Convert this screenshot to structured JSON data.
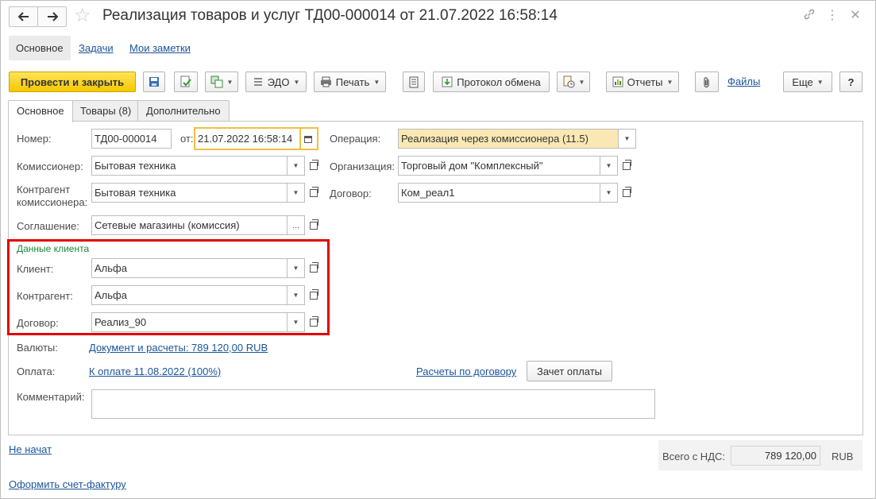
{
  "window": {
    "title": "Реализация товаров и услуг ТД00-000014 от 21.07.2022 16:58:14"
  },
  "icons": {
    "back": "arrow-left-icon",
    "forward": "arrow-right-icon",
    "favorite": "star-icon",
    "link": "link-icon",
    "more": "more-vertical-icon",
    "close": "close-icon"
  },
  "nav": {
    "main": "Основное",
    "tasks": "Задачи",
    "notes": "Мои заметки"
  },
  "toolbar": {
    "post_close": "Провести и закрыть",
    "edo": "ЭДО",
    "print": "Печать",
    "exchange_protocol": "Протокол обмена",
    "reports": "Отчеты",
    "files": "Файлы",
    "more": "Еще",
    "help": "?"
  },
  "tabs": [
    {
      "label": "Основное"
    },
    {
      "label": "Товары (8)"
    },
    {
      "label": "Дополнительно"
    }
  ],
  "form": {
    "number_label": "Номер:",
    "number_value": "ТД00-000014",
    "from_label": "от:",
    "date_value": "21.07.2022 16:58:14",
    "operation_label": "Операция:",
    "operation_value": "Реализация через комиссионера (11.5)",
    "commissioner_label": "Комиссионер:",
    "commissioner_value": "Бытовая техника",
    "organization_label": "Организация:",
    "organization_value": "Торговый дом \"Комплексный\"",
    "cp_commissioner_label_1": "Контрагент",
    "cp_commissioner_label_2": "комиссионера:",
    "cp_commissioner_value": "Бытовая техника",
    "contract_label": "Договор:",
    "contract_value": "Ком_реал1",
    "agreement_label": "Соглашение:",
    "agreement_value": "Сетевые магазины (комиссия)",
    "agreement_btn": "..."
  },
  "client": {
    "section_title": "Данные клиента",
    "client_label": "Клиент:",
    "client_value": "Альфа",
    "counterparty_label": "Контрагент:",
    "counterparty_value": "Альфа",
    "contract_label": "Договор:",
    "contract_value": "Реализ_90"
  },
  "payment": {
    "currency_label": "Валюты:",
    "currency_link": "Документ и расчеты: 789 120,00 RUB",
    "payment_label": "Оплата:",
    "payment_link": "К оплате 11.08.2022 (100%)",
    "contract_settlements_link": "Расчеты по договору",
    "offset_button": "Зачет оплаты",
    "comment_label": "Комментарий:",
    "comment_value": ""
  },
  "footer": {
    "status_link": "Не начат",
    "invoice_link": "Оформить счет-фактуру",
    "total_label": "Всего с НДС:",
    "total_value": "789 120,00",
    "currency": "RUB"
  },
  "colors": {
    "primary_button": "#f4c800",
    "link": "#1a5599",
    "highlight_field": "#fae8b4",
    "section_title": "#1a8a3c",
    "annotation_box": "#e20000"
  }
}
